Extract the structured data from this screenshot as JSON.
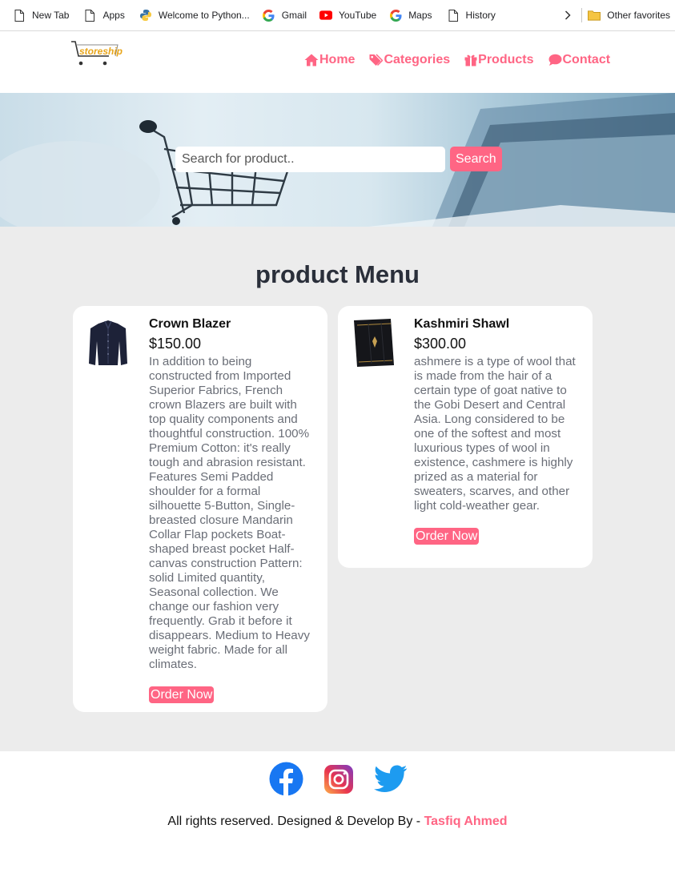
{
  "bookmarks": {
    "items": [
      {
        "label": "New Tab",
        "icon": "page-icon"
      },
      {
        "label": "Apps",
        "icon": "page-icon"
      },
      {
        "label": "Welcome to Python...",
        "icon": "python-icon"
      },
      {
        "label": "Gmail",
        "icon": "google-icon"
      },
      {
        "label": "YouTube",
        "icon": "youtube-icon"
      },
      {
        "label": "Maps",
        "icon": "google-icon"
      },
      {
        "label": "History",
        "icon": "page-icon"
      }
    ],
    "other_favorites": "Other favorites"
  },
  "header": {
    "logo_text": "storeship",
    "nav": [
      {
        "label": "Home",
        "icon": "home-icon"
      },
      {
        "label": "Categories",
        "icon": "tag-icon"
      },
      {
        "label": "Products",
        "icon": "gift-icon"
      },
      {
        "label": "Contact",
        "icon": "comment-icon"
      }
    ]
  },
  "hero": {
    "search_placeholder": "Search for product..",
    "search_button": "Search"
  },
  "products": {
    "title": "product Menu",
    "items": [
      {
        "name": "Crown Blazer",
        "price": "$150.00",
        "description": "In addition to being constructed from Imported Superior Fabrics, French crown Blazers are built with top quality components and thoughtful construction. 100% Premium Cotton: it's really tough and abrasion resistant. Features Semi Padded shoulder for a formal silhouette 5-Button, Single-breasted closure Mandarin Collar Flap pockets Boat-shaped breast pocket Half-canvas construction Pattern: solid Limited quantity, Seasonal collection. We change our fashion very frequently. Grab it before it disappears. Medium to Heavy weight fabric. Made for all climates.",
        "order_label": "Order Now",
        "image": "blazer-image"
      },
      {
        "name": "Kashmiri Shawl",
        "price": "$300.00",
        "description": "ashmere is a type of wool that is made from the hair of a certain type of goat native to the Gobi Desert and Central Asia. Long considered to be one of the softest and most luxurious types of wool in existence, cashmere is highly prized as a material for sweaters, scarves, and other light cold-weather gear.",
        "order_label": "Order Now",
        "image": "shawl-image"
      }
    ]
  },
  "footer": {
    "social": [
      "facebook-icon",
      "instagram-icon",
      "twitter-icon"
    ],
    "copyright": "All rights reserved. Designed & Develop By - ",
    "author": "Tasfiq Ahmed"
  },
  "colors": {
    "accent": "#ff6584",
    "section_bg": "#ececec"
  }
}
